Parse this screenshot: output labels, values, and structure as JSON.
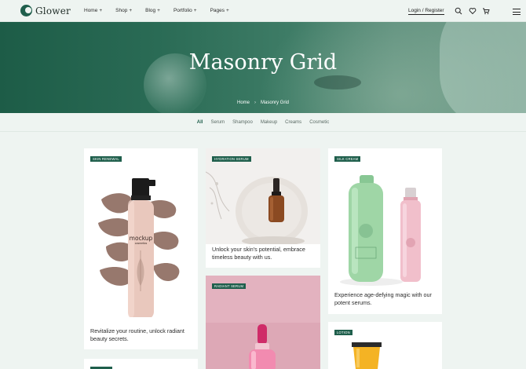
{
  "brand": {
    "name": "Glower"
  },
  "nav": [
    {
      "label": "Home"
    },
    {
      "label": "Shop"
    },
    {
      "label": "Blog"
    },
    {
      "label": "Portfolio"
    },
    {
      "label": "Pages"
    }
  ],
  "nav_plus": "+",
  "login": "Login / Register",
  "hero": {
    "title": "Masonry Grid",
    "breadcrumb_home": "Home",
    "breadcrumb_sep": "›",
    "breadcrumb_current": "Masonry Grid"
  },
  "filters": [
    {
      "label": "All",
      "active": true
    },
    {
      "label": "Serum"
    },
    {
      "label": "Shampoo"
    },
    {
      "label": "Makeup"
    },
    {
      "label": "Creams"
    },
    {
      "label": "Cosmetic"
    }
  ],
  "cards": {
    "c1": {
      "tag": "SKIN RENEWAL",
      "product_text": "mockup",
      "product_sub": "cosmetics",
      "caption1": "Revitalize your routine, unlock radiant",
      "caption2": "beauty secrets."
    },
    "c2": {
      "tag": "HYDRATION SERUM",
      "caption1": "Unlock your skin's potential, embrace",
      "caption2": "timeless beauty with us."
    },
    "c3": {
      "tag": "SILK CREAM",
      "caption1": "Experience age-defying magic with our",
      "caption2": "potent serums."
    },
    "c4": {
      "tag": "RADIANT SERUM"
    },
    "c5": {
      "tag": "LOTION"
    }
  },
  "colors": {
    "accent": "#1f5f4c",
    "background": "#eef4f1"
  }
}
